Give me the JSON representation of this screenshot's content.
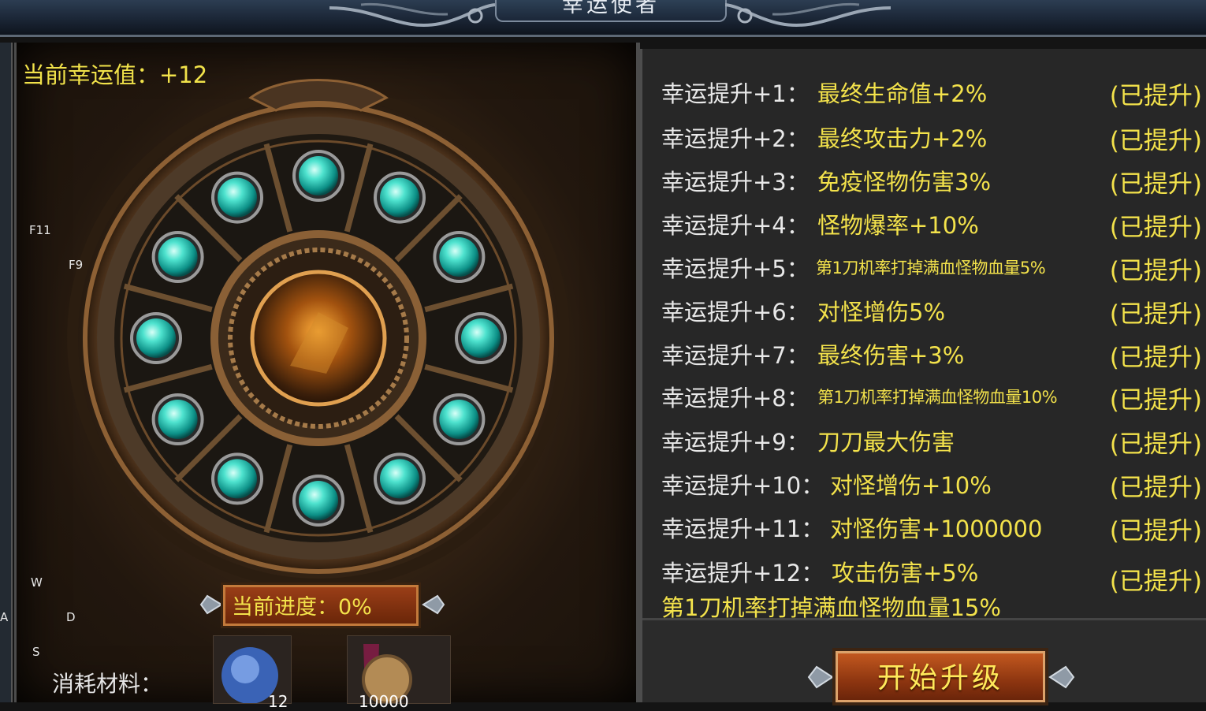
{
  "window": {
    "title": "幸运使者"
  },
  "luck": {
    "label": "当前幸运值：+12"
  },
  "key_hints": {
    "f11": "F11",
    "f9": "F9",
    "w": "W",
    "a": "A",
    "d": "D",
    "s": "S"
  },
  "wheel": {
    "gem_count": 12,
    "gem_color": "#2fd6c0",
    "bronze": "#8a5a2b"
  },
  "progress": {
    "label": "当前进度：0%",
    "value": 0
  },
  "materials": {
    "label": "消耗材料：",
    "counts": [
      "12",
      "10000"
    ]
  },
  "upgrades": [
    {
      "level": "幸运提升+1：",
      "desc": "最终生命值+2%",
      "status": "(已提升)"
    },
    {
      "level": "幸运提升+2：",
      "desc": "最终攻击力+2%",
      "status": "(已提升)"
    },
    {
      "level": "幸运提升+3：",
      "desc": "免疫怪物伤害3%",
      "status": "(已提升)"
    },
    {
      "level": "幸运提升+4：",
      "desc": "怪物爆率+10%",
      "status": "(已提升)"
    },
    {
      "level": "幸运提升+5：",
      "desc": "第1刀机率打掉满血怪物血量5%",
      "status": "(已提升)"
    },
    {
      "level": "幸运提升+6：",
      "desc": "对怪增伤5%",
      "status": "(已提升)"
    },
    {
      "level": "幸运提升+7：",
      "desc": "最终伤害+3%",
      "status": "(已提升)"
    },
    {
      "level": "幸运提升+8：",
      "desc": "第1刀机率打掉满血怪物血量10%",
      "status": "(已提升)"
    },
    {
      "level": "幸运提升+9：",
      "desc": "刀刀最大伤害",
      "status": "(已提升)"
    },
    {
      "level": "幸运提升+10：",
      "desc": "对怪增伤+10%",
      "status": "(已提升)"
    },
    {
      "level": "幸运提升+11：",
      "desc": "对怪伤害+1000000",
      "status": "(已提升)"
    },
    {
      "level": "幸运提升+12：",
      "desc": "攻击伤害+5%",
      "status": "(已提升)"
    }
  ],
  "upgrade_extra": "第1刀机率打掉满血怪物血量15%",
  "upgrade_button": {
    "label": "开始升级"
  },
  "colors": {
    "yellow": "#f3e24b",
    "white": "#e8e8e8",
    "panel": "#272727",
    "button": "#b44d1a"
  }
}
